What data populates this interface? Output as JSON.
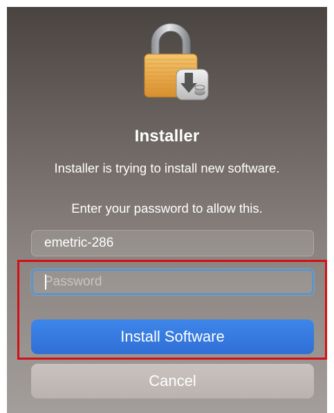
{
  "dialog": {
    "title": "Installer",
    "message": "Installer is trying to install new software.",
    "prompt": "Enter your password to allow this.",
    "username_value": "emetric-286",
    "password_placeholder": "Password",
    "install_button_label": "Install Software",
    "cancel_button_label": "Cancel",
    "icon": "lock-with-installer-badge-icon"
  },
  "colors": {
    "accent": "#2f6fd6",
    "focus_ring": "#5d95c8",
    "highlight_box": "#d40f14"
  }
}
